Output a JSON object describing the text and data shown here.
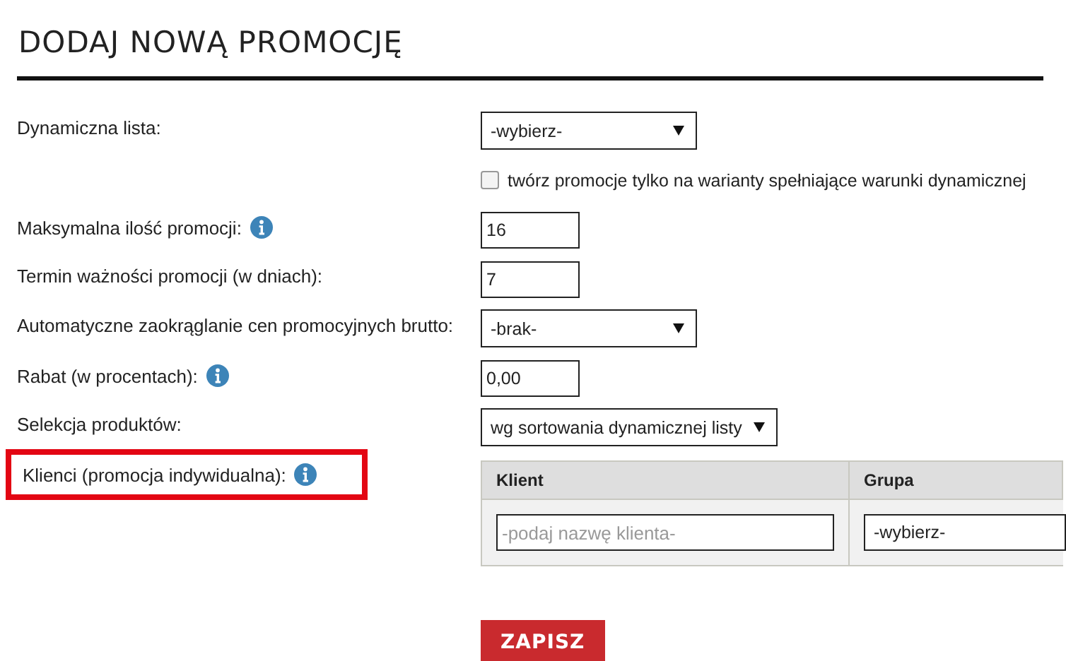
{
  "title": "DODAJ NOWĄ PROMOCJĘ",
  "rows": [
    {
      "kind": "select",
      "label": "Dynamiczna lista:",
      "info": false,
      "highlighted": false,
      "value": "-wybierz-"
    },
    {
      "kind": "checkbox",
      "label": "twórz promocje tylko na warianty spełniające warunki dynamicznej",
      "checked": false
    },
    {
      "kind": "input",
      "label": "Maksymalna ilość promocji:",
      "info": true,
      "highlighted": false,
      "value": "16"
    },
    {
      "kind": "input",
      "label": "Termin ważności promocji (w dniach):",
      "info": false,
      "highlighted": false,
      "value": "7"
    },
    {
      "kind": "select",
      "label": "Automatyczne zaokrąglanie cen promocyjnych brutto:",
      "info": false,
      "highlighted": false,
      "value": "-brak-"
    },
    {
      "kind": "input",
      "label": "Rabat (w procentach):",
      "info": true,
      "highlighted": false,
      "value": "0,00"
    },
    {
      "kind": "select",
      "label": "Selekcja produktów:",
      "info": false,
      "highlighted": false,
      "value": "wg sortowania dynamicznej listy"
    },
    {
      "kind": "table",
      "label": "Klienci (promocja indywidualna):",
      "info": true,
      "highlighted": true,
      "columns": [
        "Klient",
        "Grupa"
      ],
      "client": {
        "placeholder": "-podaj nazwę klienta-"
      },
      "group": {
        "value": "-wybierz-"
      }
    }
  ],
  "submit": "ZAPISZ"
}
